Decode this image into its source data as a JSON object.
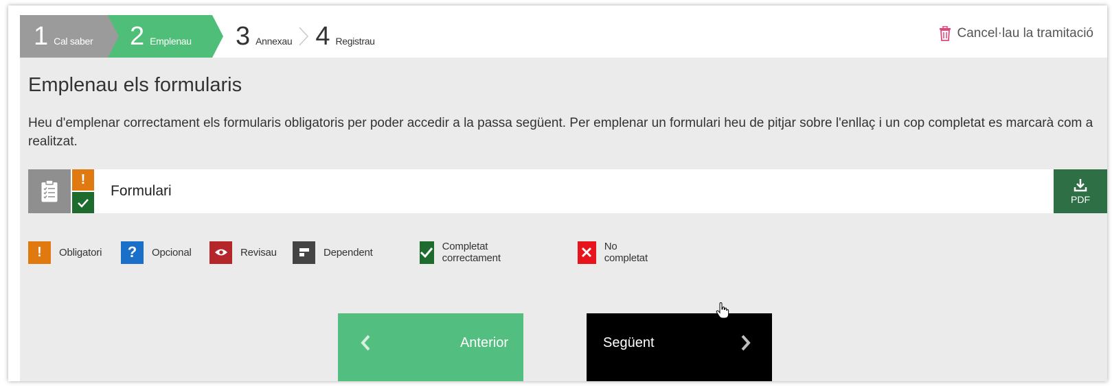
{
  "stepper": {
    "steps": [
      {
        "number": "1",
        "label": "Cal saber",
        "state": "done"
      },
      {
        "number": "2",
        "label": "Emplenau",
        "state": "current"
      },
      {
        "number": "3",
        "label": "Annexau",
        "state": "pending"
      },
      {
        "number": "4",
        "label": "Registrau",
        "state": "pending"
      }
    ],
    "cancel_label": "Cancel·lau la tramitació"
  },
  "main": {
    "title": "Emplenau els formularis",
    "description": "Heu d'emplenar correctament els formularis obligatoris per poder accedir a la passa següent. Per emplenar un formulari heu de pitjar sobre l'enllaç i un cop completat es marcarà com a realitzat.",
    "form": {
      "name": "Formulari",
      "required_mark": "!",
      "pdf_label": "PDF"
    }
  },
  "legend": {
    "items": [
      {
        "icon": "exclamation-icon",
        "label": "Obligatori",
        "color": "#e07a10"
      },
      {
        "icon": "question-icon",
        "label": "Opcional",
        "color": "#1a6fc9"
      },
      {
        "icon": "eye-icon",
        "label": "Revisau",
        "color": "#b5262b"
      },
      {
        "icon": "dependent-icon",
        "label": "Dependent",
        "color": "#444444"
      },
      {
        "icon": "check-icon",
        "label": "Completat correctament",
        "color": "#1d6b2d"
      },
      {
        "icon": "x-icon",
        "label": "No completat",
        "color": "#e8141c"
      }
    ]
  },
  "nav": {
    "prev_label": "Anterior",
    "next_label": "Següent"
  },
  "colors": {
    "step_done": "#9b9b9b",
    "step_current": "#4fbe78",
    "pdf_button": "#2e6f46",
    "prev_button": "#52be80",
    "next_button": "#000000",
    "cancel_icon": "#e0457b"
  }
}
